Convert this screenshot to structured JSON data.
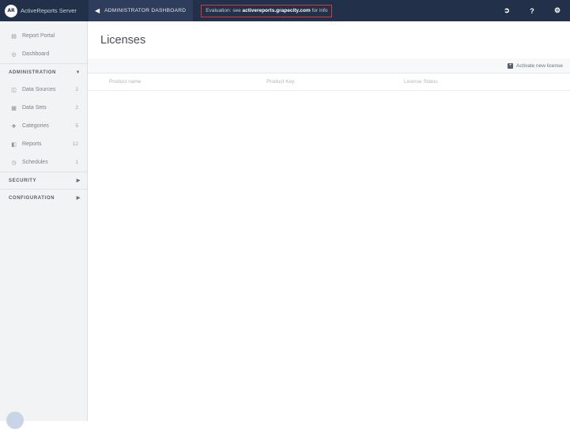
{
  "topbar": {
    "brand_logo": "AR",
    "brand_name": "ActiveReports Server",
    "admin_label": "ADMINISTRATOR DASHBOARD",
    "eval_prefix": "Evaluation: see ",
    "eval_link": "activereports.grapecity.com",
    "eval_suffix": " for info",
    "icons": [
      "sign-out-icon",
      "help-icon",
      "settings-icon"
    ]
  },
  "sidebar": {
    "top_items": [
      {
        "label": "Report Portal",
        "icon": "portal-icon"
      },
      {
        "label": "Dashboard",
        "icon": "dashboard-icon"
      }
    ],
    "administration": {
      "label": "ADMINISTRATION",
      "items": [
        {
          "label": "Data Sources",
          "count": "2",
          "icon": "database-icon"
        },
        {
          "label": "Data Sets",
          "count": "2",
          "icon": "table-icon"
        },
        {
          "label": "Categories",
          "count": "5",
          "icon": "tags-icon"
        },
        {
          "label": "Reports",
          "count": "12",
          "icon": "report-icon"
        },
        {
          "label": "Schedules",
          "count": "1",
          "icon": "clock-icon"
        }
      ]
    },
    "security": {
      "label": "SECURITY"
    },
    "configuration": {
      "label": "CONFIGURATION"
    }
  },
  "main": {
    "title": "Licenses",
    "activate_label": "Activate new license",
    "columns": [
      "Product name",
      "Product Key",
      "License Status"
    ]
  },
  "colors": {
    "topbar_bg": "#23304a",
    "eval_border": "#d73838",
    "sidebar_bg": "#f2f3f5"
  }
}
